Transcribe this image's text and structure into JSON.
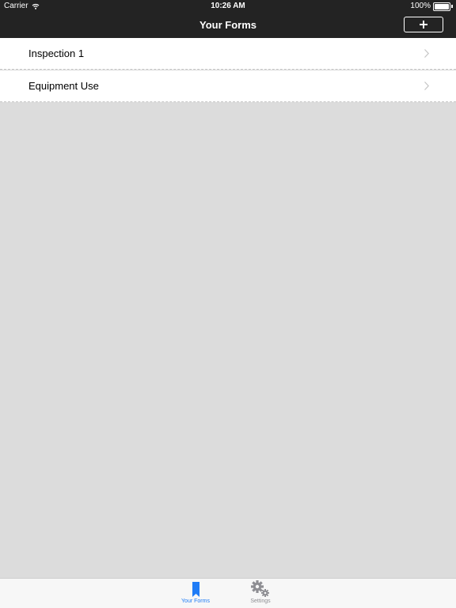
{
  "status_bar": {
    "carrier": "Carrier",
    "time": "10:26 AM",
    "battery": "100%"
  },
  "nav": {
    "title": "Your Forms",
    "add_icon": "plus-icon"
  },
  "forms": [
    {
      "label": "Inspection 1"
    },
    {
      "label": "Equipment Use"
    }
  ],
  "tabs": [
    {
      "label": "Your Forms",
      "icon": "bookmark-icon",
      "selected": true
    },
    {
      "label": "Settings",
      "icon": "gear-icon",
      "selected": false
    }
  ],
  "colors": {
    "nav_background": "#232323",
    "accent": "#1f7cf6",
    "background": "#dcdcdc"
  }
}
